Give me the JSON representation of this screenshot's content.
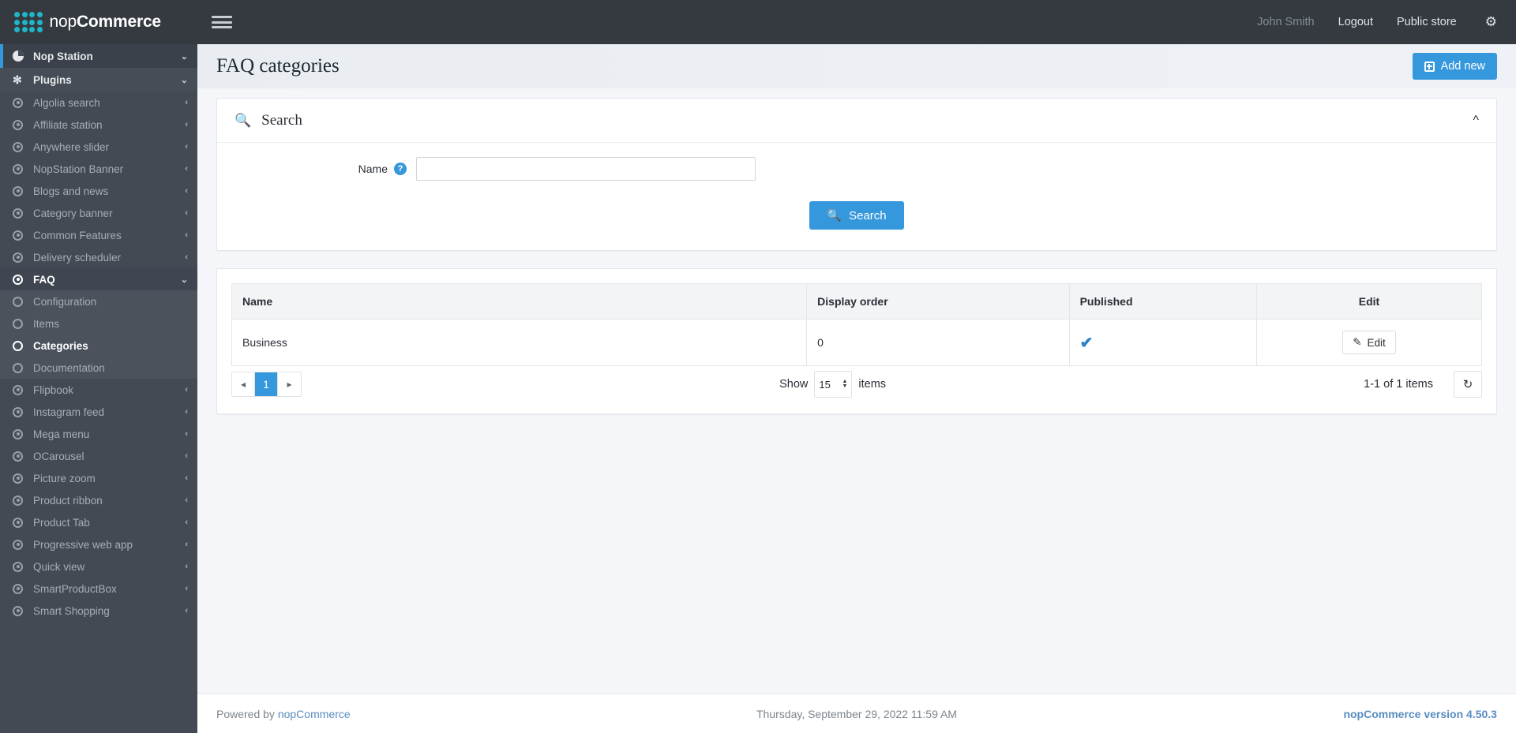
{
  "brand": {
    "prefix": "nop",
    "bold": "Commerce"
  },
  "topbar": {
    "menu_toggle": "hamburger-menu",
    "user": "John Smith",
    "logout": "Logout",
    "public_store": "Public store",
    "settings_icon": "gear-icon"
  },
  "page": {
    "title": "FAQ categories",
    "add_new": "Add new"
  },
  "sidebar": {
    "top": [
      {
        "label": "Nop Station",
        "icon": "pie-icon",
        "arrow": "⌄",
        "type": "header-top"
      },
      {
        "label": "Plugins",
        "icon": "puzzle-icon",
        "arrow": "⌄",
        "type": "header-plugins"
      }
    ],
    "items": [
      {
        "label": "Algolia search",
        "icon": "circle-dot-icon",
        "arrow": "‹"
      },
      {
        "label": "Affiliate station",
        "icon": "circle-dot-icon",
        "arrow": "‹"
      },
      {
        "label": "Anywhere slider",
        "icon": "circle-dot-icon",
        "arrow": "‹"
      },
      {
        "label": "NopStation Banner",
        "icon": "circle-dot-icon",
        "arrow": "‹"
      },
      {
        "label": "Blogs and news",
        "icon": "circle-dot-icon",
        "arrow": "‹"
      },
      {
        "label": "Category banner",
        "icon": "circle-dot-icon",
        "arrow": "‹"
      },
      {
        "label": "Common Features",
        "icon": "circle-dot-icon",
        "arrow": "‹"
      },
      {
        "label": "Delivery scheduler",
        "icon": "circle-dot-icon",
        "arrow": "‹"
      }
    ],
    "faq": {
      "label": "FAQ",
      "icon": "circle-dot-icon",
      "arrow": "⌄"
    },
    "faq_children": [
      {
        "label": "Configuration",
        "icon": "circle-hollow-icon",
        "active": false
      },
      {
        "label": "Items",
        "icon": "circle-hollow-icon",
        "active": false
      },
      {
        "label": "Categories",
        "icon": "circle-hollow-icon",
        "active": true
      },
      {
        "label": "Documentation",
        "icon": "circle-hollow-icon",
        "active": false
      }
    ],
    "items_after": [
      {
        "label": "Flipbook",
        "icon": "circle-dot-icon",
        "arrow": "‹"
      },
      {
        "label": "Instagram feed",
        "icon": "circle-dot-icon",
        "arrow": "‹"
      },
      {
        "label": "Mega menu",
        "icon": "circle-dot-icon",
        "arrow": "‹"
      },
      {
        "label": "OCarousel",
        "icon": "circle-dot-icon",
        "arrow": "‹"
      },
      {
        "label": "Picture zoom",
        "icon": "circle-dot-icon",
        "arrow": "‹"
      },
      {
        "label": "Product ribbon",
        "icon": "circle-dot-icon",
        "arrow": "‹"
      },
      {
        "label": "Product Tab",
        "icon": "circle-dot-icon",
        "arrow": "‹"
      },
      {
        "label": "Progressive web app",
        "icon": "circle-dot-icon",
        "arrow": "‹"
      },
      {
        "label": "Quick view",
        "icon": "circle-dot-icon",
        "arrow": "‹"
      },
      {
        "label": "SmartProductBox",
        "icon": "circle-dot-icon",
        "arrow": "‹"
      },
      {
        "label": "Smart Shopping",
        "icon": "circle-dot-icon",
        "arrow": "‹"
      }
    ]
  },
  "search_panel": {
    "icon": "search-icon",
    "title": "Search",
    "collapse_icon": "chevron-up-icon",
    "name_label": "Name",
    "name_help": "?",
    "name_value": "",
    "name_placeholder": "",
    "search_button": "Search"
  },
  "table": {
    "columns": [
      "Name",
      "Display order",
      "Published",
      "Edit"
    ],
    "rows": [
      {
        "name": "Business",
        "display_order": "0",
        "published": true,
        "edit_label": "Edit"
      }
    ],
    "published_check": "✔",
    "edit_icon": "pencil-icon"
  },
  "pagination": {
    "prev": "◂",
    "page": "1",
    "next": "▸",
    "show_label": "Show",
    "page_size": "15",
    "items_label": "items",
    "info": "1-1 of 1 items",
    "refresh_icon": "refresh-icon"
  },
  "footer": {
    "powered_by": "Powered by",
    "powered_link": "nopCommerce",
    "datetime": "Thursday, September 29, 2022 11:59 AM",
    "version": "nopCommerce version 4.50.3"
  },
  "colors": {
    "accent": "#3598dc",
    "sidebar": "#434a54",
    "topbar": "#343a40",
    "logo": "#1fb6c9",
    "check": "#2d82c7"
  }
}
